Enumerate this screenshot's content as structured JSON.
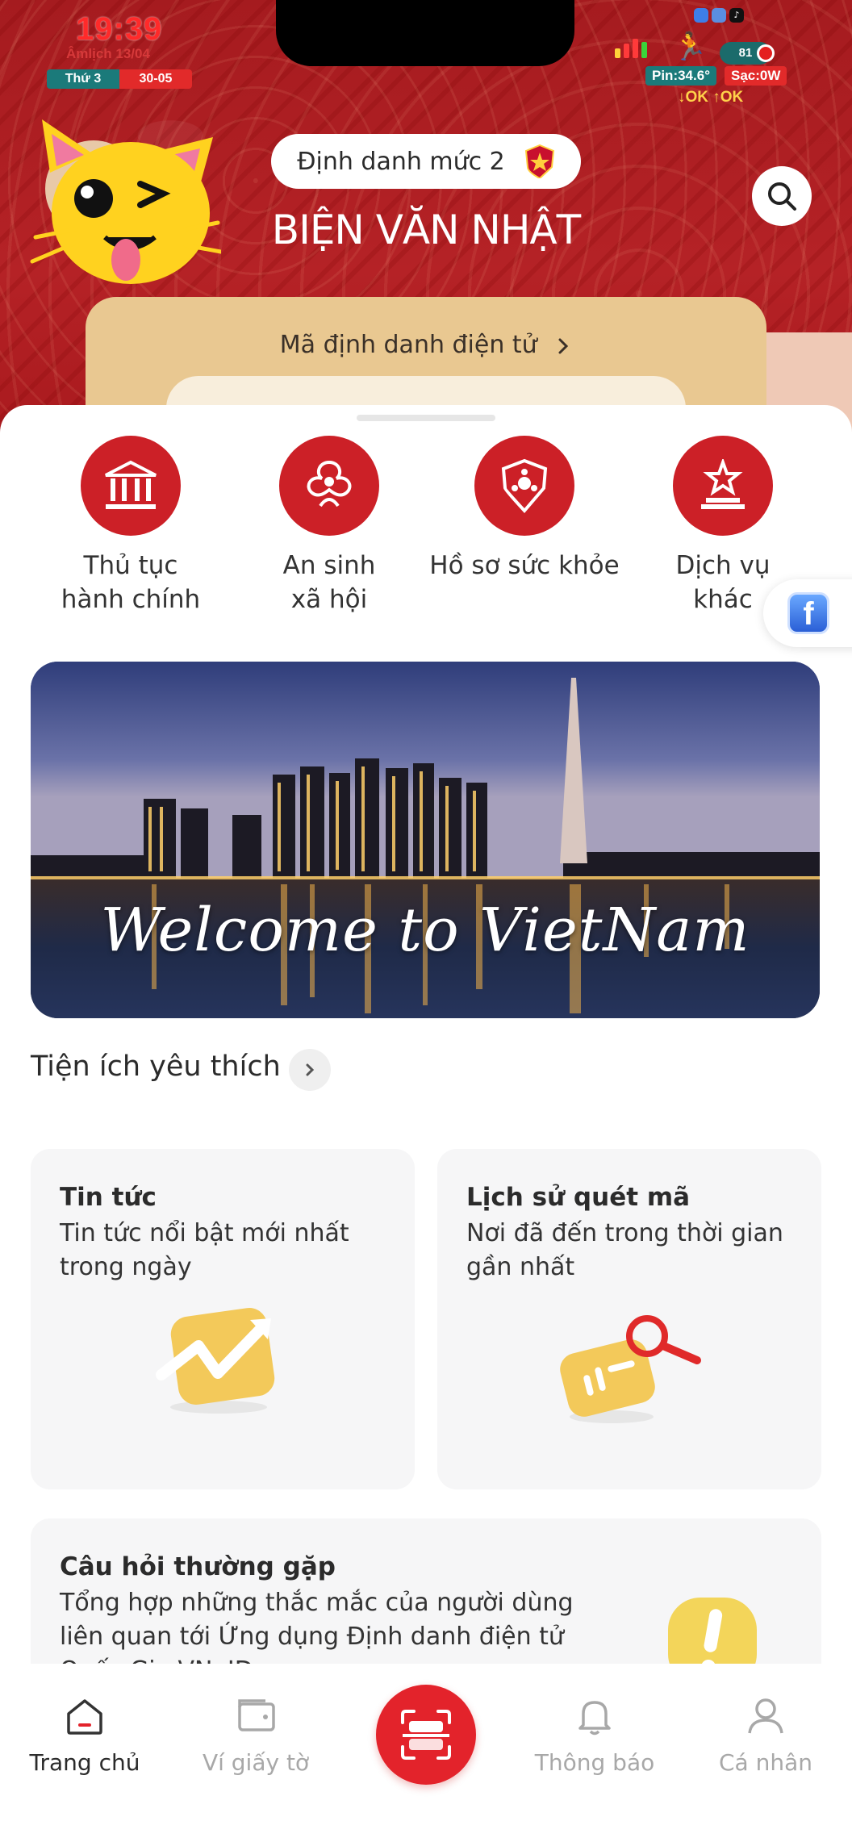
{
  "status_bar": {
    "time": "19:39",
    "lunar": "Âmlịch 13/04",
    "weekday": "Thứ 3",
    "date": "30-05",
    "battery": "81",
    "pin": "Pin:34.6°",
    "sac": "Sạc:0W",
    "net": "↓OK ↑OK"
  },
  "header": {
    "level_label": "Định danh mức 2",
    "user_name": "BIỆN VĂN NHẬT",
    "id_card_title": "Mã định danh điện tử",
    "search_icon": "search-icon"
  },
  "services": [
    {
      "label": "Thủ tục\nhành chính",
      "icon": "government-building-icon"
    },
    {
      "label": "An sinh\nxã hội",
      "icon": "social-welfare-icon"
    },
    {
      "label": "Hồ sơ sức khỏe",
      "icon": "health-shield-icon"
    },
    {
      "label": "Dịch vụ\nkhác",
      "icon": "star-podium-icon"
    }
  ],
  "banner": {
    "text": "Welcome to VietNam"
  },
  "favorites": {
    "title": "Tiện ích yêu thích",
    "cards": [
      {
        "title": "Tin tức",
        "desc": "Tin tức nổi bật mới nhất trong ngày"
      },
      {
        "title": "Lịch sử quét mã",
        "desc": "Nơi đã đến trong thời gian gần nhất"
      },
      {
        "title": "Câu hỏi thường gặp",
        "desc": "Tổng hợp những thắc mắc của người dùng liên quan tới Ứng dụng Định danh điện tử Quốc Gia VNeID"
      }
    ]
  },
  "bottom_nav": {
    "items": [
      {
        "label": "Trang chủ",
        "icon": "home-icon"
      },
      {
        "label": "Ví giấy tờ",
        "icon": "wallet-icon"
      },
      {
        "label": "",
        "icon": "scan-qr-icon"
      },
      {
        "label": "Thông báo",
        "icon": "bell-icon"
      },
      {
        "label": "Cá nhân",
        "icon": "user-icon"
      }
    ]
  },
  "colors": {
    "brand_red": "#cc2027",
    "header_red": "#a51b1f",
    "card_gold": "#e9c891"
  }
}
